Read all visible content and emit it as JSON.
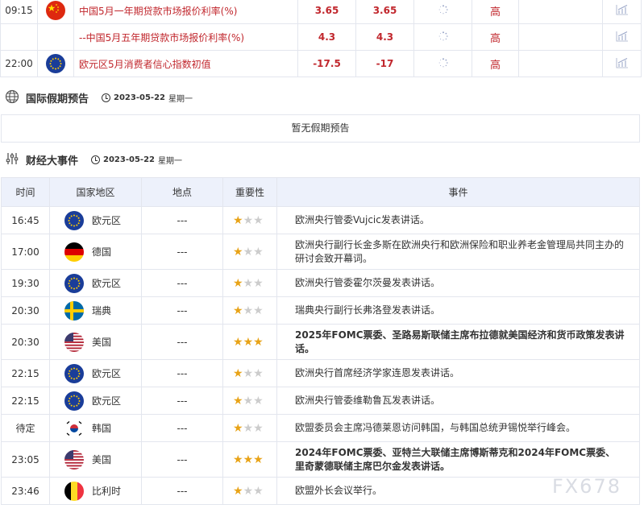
{
  "top_rows": [
    {
      "time": "09:15",
      "flag": "cn",
      "name": "中国5月一年期贷款市场报价利率(%)",
      "prev": "3.65",
      "forecast": "3.65",
      "importance": "高",
      "show_time": true,
      "show_flag": true
    },
    {
      "time": "",
      "flag": "",
      "name": "--中国5月五年期贷款市场报价利率(%)",
      "prev": "4.3",
      "forecast": "4.3",
      "importance": "高",
      "show_time": false,
      "show_flag": false
    },
    {
      "time": "22:00",
      "flag": "eu",
      "name": "欧元区5月消费者信心指数初值",
      "prev": "-17.5",
      "forecast": "-17",
      "importance": "高",
      "show_time": true,
      "show_flag": true
    }
  ],
  "holiday_section": {
    "title": "国际假期预告",
    "date": "2023-05-22",
    "weekday": "星期一",
    "empty_text": "暂无假期预告"
  },
  "events_section": {
    "title": "财经大事件",
    "date": "2023-05-22",
    "weekday": "星期一",
    "headers": {
      "time": "时间",
      "country": "国家地区",
      "location": "地点",
      "importance": "重要性",
      "event": "事件"
    },
    "rows": [
      {
        "time": "16:45",
        "flag": "eu",
        "country": "欧元区",
        "location": "---",
        "stars": 1,
        "event": "欧洲央行管委Vujcic发表讲话。",
        "highlight": false
      },
      {
        "time": "17:00",
        "flag": "de",
        "country": "德国",
        "location": "---",
        "stars": 1,
        "event": "欧洲央行副行长金多斯在欧洲央行和欧洲保险和职业养老金管理局共同主办的研讨会致开幕词。",
        "highlight": false
      },
      {
        "time": "19:30",
        "flag": "eu",
        "country": "欧元区",
        "location": "---",
        "stars": 1,
        "event": "欧洲央行管委霍尔茨曼发表讲话。",
        "highlight": false
      },
      {
        "time": "20:30",
        "flag": "se",
        "country": "瑞典",
        "location": "---",
        "stars": 1,
        "event": "瑞典央行副行长弗洛登发表讲话。",
        "highlight": false
      },
      {
        "time": "20:30",
        "flag": "us",
        "country": "美国",
        "location": "---",
        "stars": 3,
        "event": "2025年FOMC票委、圣路易斯联储主席布拉德就美国经济和货币政策发表讲话。",
        "highlight": true
      },
      {
        "time": "22:15",
        "flag": "eu",
        "country": "欧元区",
        "location": "---",
        "stars": 1,
        "event": "欧洲央行首席经济学家连恩发表讲话。",
        "highlight": false
      },
      {
        "time": "22:15",
        "flag": "eu",
        "country": "欧元区",
        "location": "---",
        "stars": 1,
        "event": "欧洲央行管委维勒鲁瓦发表讲话。",
        "highlight": false
      },
      {
        "time": "待定",
        "flag": "kr",
        "country": "韩国",
        "location": "---",
        "stars": 1,
        "event": "欧盟委员会主席冯德莱恩访问韩国，与韩国总统尹锡悦举行峰会。",
        "highlight": false
      },
      {
        "time": "23:05",
        "flag": "us",
        "country": "美国",
        "location": "---",
        "stars": 3,
        "event": "2024年FOMC票委、亚特兰大联储主席博斯蒂克和2024年FOMC票委、里奇蒙德联储主席巴尔金发表讲话。",
        "highlight": true
      },
      {
        "time": "23:46",
        "flag": "be",
        "country": "比利时",
        "location": "---",
        "stars": 1,
        "event": "欧盟外长会议举行。",
        "highlight": false
      }
    ]
  },
  "watermark": "FX678",
  "colors": {
    "accent_red": "#c1272d",
    "header_bg": "#edf1fb",
    "star_on": "#e8a317",
    "star_off": "#cccccc"
  }
}
